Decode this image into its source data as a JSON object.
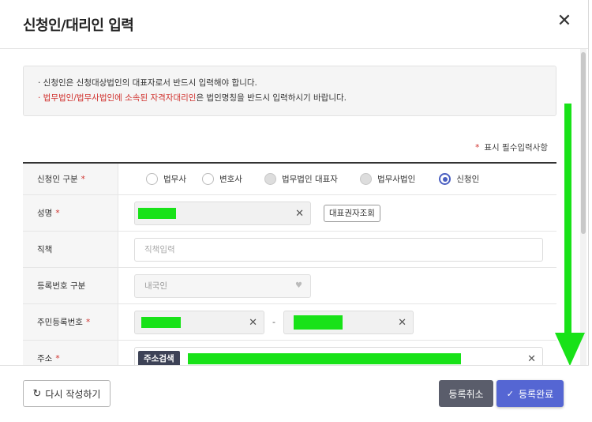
{
  "dialog": {
    "title": "신청인/대리인 입력",
    "close_icon": "close-icon"
  },
  "notice": {
    "line1": "· 신청인은 신청대상법인의 대표자로서 반드시 입력해야 합니다.",
    "line2_red": "· 법무법인/법무사법인에 소속된 자격자대리인",
    "line2_rest": "은 법인명칭을 반드시 입력하시기 바랍니다."
  },
  "required_note": {
    "star": "*",
    "text": "표시 필수입력사항"
  },
  "form": {
    "applicant_type": {
      "label": "신청인 구분",
      "star": "*",
      "options": [
        {
          "label": "법무사",
          "state": "unchecked"
        },
        {
          "label": "변호사",
          "state": "unchecked"
        },
        {
          "label": "법무법인 대표자",
          "state": "disabled"
        },
        {
          "label": "법무사법인",
          "state": "disabled"
        },
        {
          "label": "신청인",
          "state": "checked"
        }
      ]
    },
    "name": {
      "label": "성명",
      "star": "*",
      "lookup_button": "대표권자조회"
    },
    "position": {
      "label": "직책",
      "placeholder": "직책입력"
    },
    "reg_type": {
      "label": "등록번호 구분",
      "value": "내국인"
    },
    "resident_no": {
      "label": "주민등록번호",
      "star": "*",
      "separator": "-"
    },
    "address": {
      "label": "주소",
      "star": "*",
      "search_button": "주소검색"
    }
  },
  "footer": {
    "reset_label": "다시 작성하기",
    "cancel_label": "등록취소",
    "done_label": "등록완료"
  },
  "colors": {
    "accent": "#5566d3",
    "required_red": "#d0312d",
    "redaction_green": "#18e218"
  }
}
